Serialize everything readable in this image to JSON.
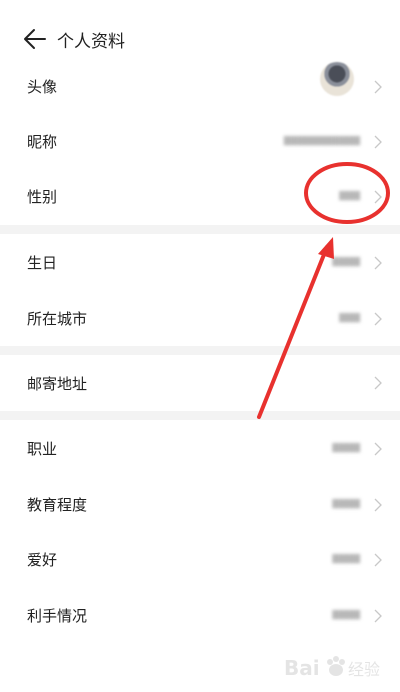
{
  "header": {
    "back_icon": "arrow-left-icon",
    "title": "个人资料"
  },
  "profile": {
    "avatar_label": "头像",
    "nickname_label": "昵称",
    "gender_label": "性别",
    "birthday_label": "生日",
    "city_label": "所在城市",
    "address_label": "邮寄地址",
    "job_label": "职业",
    "education_label": "教育程度",
    "hobby_label": "爱好",
    "handedness_label": "利手情况"
  },
  "annotation": {
    "color": "#e8312e"
  },
  "watermark": {
    "text": "Bai 经验"
  }
}
